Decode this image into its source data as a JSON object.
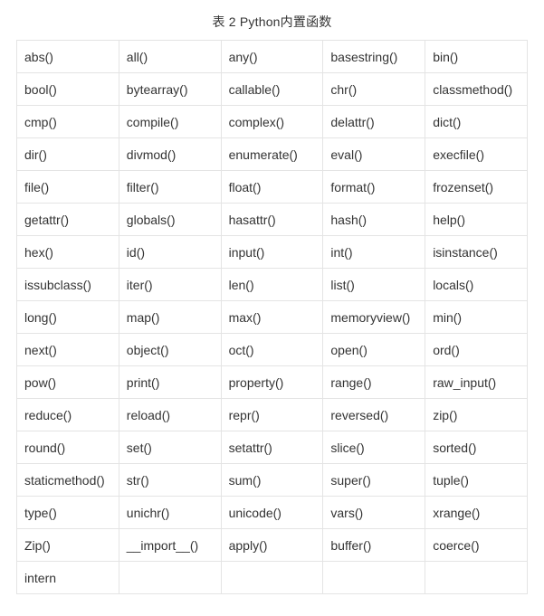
{
  "caption": "表 2 Python内置函数",
  "rows": [
    [
      "abs()",
      "all()",
      "any()",
      "basestring()",
      "bin()"
    ],
    [
      "bool()",
      "bytearray()",
      "callable()",
      "chr()",
      "classmethod()"
    ],
    [
      "cmp()",
      "compile()",
      "complex()",
      "delattr()",
      "dict()"
    ],
    [
      "dir()",
      "divmod()",
      "enumerate()",
      "eval()",
      "execfile()"
    ],
    [
      "file()",
      "filter()",
      "float()",
      "format()",
      "frozenset()"
    ],
    [
      "getattr()",
      "globals()",
      "hasattr()",
      "hash()",
      "help()"
    ],
    [
      "hex()",
      "id()",
      "input()",
      "int()",
      "isinstance()"
    ],
    [
      "issubclass()",
      "iter()",
      "len()",
      "list()",
      "locals()"
    ],
    [
      "long()",
      "map()",
      "max()",
      "memoryview()",
      "min()"
    ],
    [
      "next()",
      "object()",
      "oct()",
      "open()",
      "ord()"
    ],
    [
      "pow()",
      "print()",
      "property()",
      "range()",
      "raw_input()"
    ],
    [
      "reduce()",
      "reload()",
      "repr()",
      "reversed()",
      "zip()"
    ],
    [
      "round()",
      "set()",
      "setattr()",
      "slice()",
      "sorted()"
    ],
    [
      "staticmethod()",
      "str()",
      "sum()",
      "super()",
      "tuple()"
    ],
    [
      "type()",
      "unichr()",
      "unicode()",
      "vars()",
      "xrange()"
    ],
    [
      "Zip()",
      "__import__()",
      "apply()",
      "buffer()",
      "coerce()"
    ],
    [
      "intern",
      "",
      "",
      "",
      ""
    ]
  ]
}
